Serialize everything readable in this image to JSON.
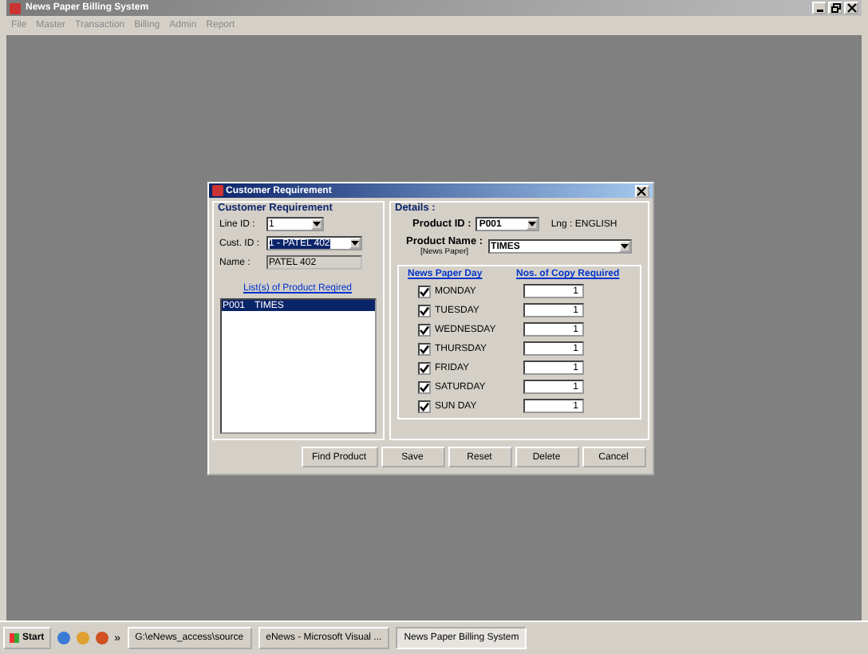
{
  "window": {
    "title": "News Paper Billing System"
  },
  "menu": [
    "File",
    "Master",
    "Transaction",
    "Billing",
    "Admin",
    "Report"
  ],
  "dialog": {
    "title": "Customer Requirement",
    "customer": {
      "title": "Customer Requirement",
      "line_id": {
        "label": "Line ID :",
        "value": "1"
      },
      "cust_id": {
        "label": "Cust. ID :",
        "value": "1 - PATEL 402"
      },
      "name": {
        "label": "Name :",
        "value": "PATEL 402"
      },
      "list_title": "List(s) of Product Reqired",
      "rows": [
        {
          "code": "P001",
          "name": "TIMES",
          "selected": true
        }
      ]
    },
    "details": {
      "title": "Details :",
      "product_id": {
        "label": "Product ID :",
        "value": "P001"
      },
      "language": "Lng : ENGLISH",
      "product_name": {
        "label": "Product Name :",
        "sublabel": "[News Paper]",
        "value": "TIMES"
      },
      "day_header": "News Paper Day",
      "copy_header": "Nos. of Copy Required",
      "days": [
        {
          "label": "MONDAY",
          "checked": true,
          "copies": "1"
        },
        {
          "label": "TUESDAY",
          "checked": true,
          "copies": "1"
        },
        {
          "label": "WEDNESDAY",
          "checked": true,
          "copies": "1"
        },
        {
          "label": "THURSDAY",
          "checked": true,
          "copies": "1"
        },
        {
          "label": "FRIDAY",
          "checked": true,
          "copies": "1"
        },
        {
          "label": "SATURDAY",
          "checked": true,
          "copies": "1"
        },
        {
          "label": "SUN DAY",
          "checked": true,
          "copies": "1"
        }
      ]
    },
    "buttons": [
      "Find Product",
      "Save",
      "Reset",
      "Delete",
      "Cancel"
    ]
  },
  "taskbar": {
    "start": "Start",
    "more": "»",
    "tasks": [
      {
        "label": "G:\\eNews_access\\source",
        "selected": false
      },
      {
        "label": "eNews - Microsoft Visual ...",
        "selected": false
      },
      {
        "label": "News Paper Billing System",
        "selected": true
      }
    ]
  }
}
